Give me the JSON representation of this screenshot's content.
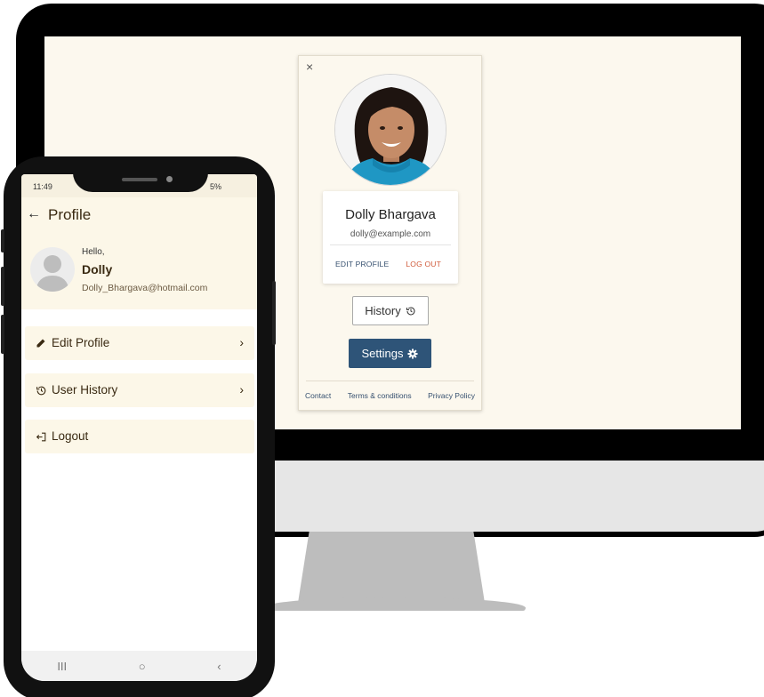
{
  "desktop_card": {
    "close": "×",
    "name": "Dolly Bhargava",
    "email": "dolly@example.com",
    "edit_profile": "EDIT PROFILE",
    "log_out": "LOG OUT",
    "history": "History",
    "settings": "Settings",
    "footer": {
      "contact": "Contact",
      "terms": "Terms & conditions",
      "privacy": "Privacy Policy"
    }
  },
  "phone": {
    "status_time": "11:49",
    "status_battery": "5%",
    "header_back": "←",
    "header_title": "Profile",
    "hello": "Hello,",
    "user_name": "Dolly",
    "user_email": "Dolly_Bhargava@hotmail.com",
    "menu": [
      {
        "label": "Edit Profile",
        "icon": "pencil-icon",
        "chevron": "›"
      },
      {
        "label": "User History",
        "icon": "history-icon",
        "chevron": "›"
      },
      {
        "label": "Logout",
        "icon": "logout-icon"
      }
    ],
    "nav": {
      "recent": "III",
      "home": "○",
      "back": "‹"
    }
  },
  "colors": {
    "screen_bg": "#fcf8ee",
    "accent_dark": "#2e5478",
    "logout_red": "#d05a3a",
    "phone_header_bg": "#fcf7e8",
    "phone_text": "#3a2a12"
  }
}
